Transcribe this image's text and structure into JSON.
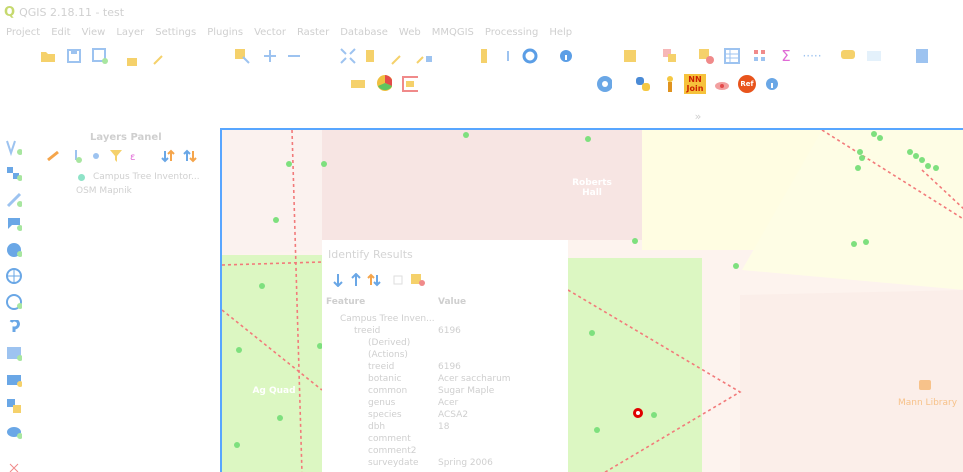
{
  "window": {
    "title": "QGIS 2.18.11 - test",
    "logo": "Q"
  },
  "menu": [
    "Project",
    "Edit",
    "View",
    "Layer",
    "Settings",
    "Plugins",
    "Vector",
    "Raster",
    "Database",
    "Web",
    "MMQGIS",
    "Processing",
    "Help"
  ],
  "toolbar_icons": [
    "open-project-icon",
    "save-project-icon",
    "save-as-icon",
    "new-layer-icon",
    "digitize-icon",
    "select-icon",
    "add-feature-icon",
    "zoom-icon",
    "pan-icon",
    "refresh-icon",
    "identify-icon",
    "attribute-table-icon",
    "statistics-icon",
    "measure-icon",
    "map-tips-icon",
    "help-icon",
    "python-icon",
    "nnjoin-icon",
    "ref-icon"
  ],
  "toolbar_labels": {
    "sigma": "Σ",
    "nnjoin": "NN Join",
    "ref": "Ref",
    "measure": "·····",
    "more": "»"
  },
  "layers_panel": {
    "title": "Layers Panel",
    "layers": [
      {
        "name": "Campus Tree Inventor...",
        "color": "#8fe3c8"
      }
    ],
    "basemap": "OSM Mapnik"
  },
  "map": {
    "labels": [
      {
        "text": "Roberts Hall"
      },
      {
        "text": "Ag Quad"
      }
    ],
    "library_label": "Mann Library"
  },
  "identify": {
    "title": "Identify Results",
    "columns": {
      "feature": "Feature",
      "value": "Value"
    },
    "rows": [
      {
        "key": "Campus Tree Inven...",
        "value": "",
        "indent": 1
      },
      {
        "key": "treeid",
        "value": "6196",
        "indent": 2
      },
      {
        "key": "(Derived)",
        "value": "",
        "indent": 3
      },
      {
        "key": "(Actions)",
        "value": "",
        "indent": 3
      },
      {
        "key": "treeid",
        "value": "6196",
        "indent": 3
      },
      {
        "key": "botanic",
        "value": "Acer saccharum",
        "indent": 3
      },
      {
        "key": "common",
        "value": "Sugar Maple",
        "indent": 3
      },
      {
        "key": "genus",
        "value": "Acer",
        "indent": 3
      },
      {
        "key": "species",
        "value": "ACSA2",
        "indent": 3
      },
      {
        "key": "dbh",
        "value": "18",
        "indent": 3
      },
      {
        "key": "comment",
        "value": "",
        "indent": 3
      },
      {
        "key": "comment2",
        "value": "",
        "indent": 3
      },
      {
        "key": "surveydate",
        "value": "Spring 2006",
        "indent": 3
      }
    ]
  },
  "colors": {
    "accent": "#58a6ff",
    "tree_point": "#7ee07e",
    "selected": "#e00000",
    "grass": "#dcf7c2",
    "campus": "#fdf3ee",
    "path": "#f27a7a"
  }
}
